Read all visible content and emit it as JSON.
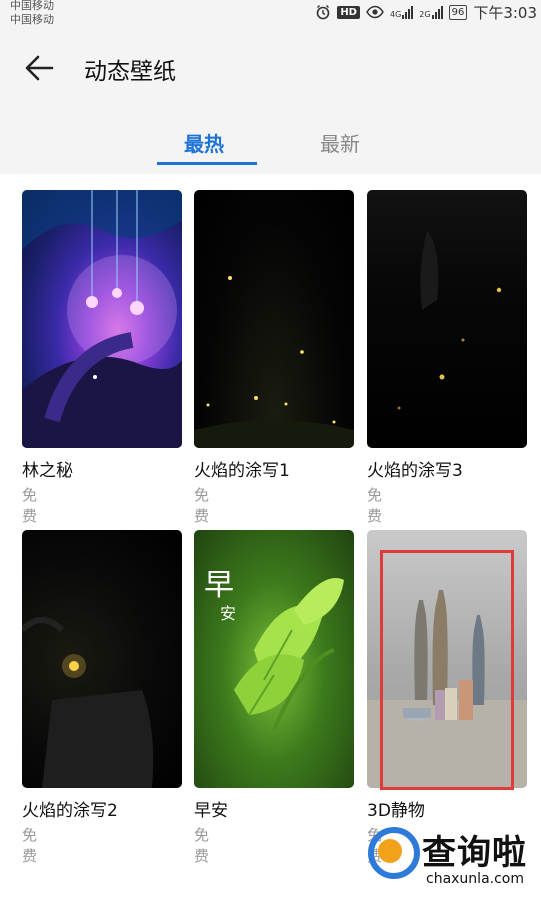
{
  "status_bar": {
    "carrier_1": "中国移动",
    "carrier_2": "中国移动",
    "hd_label": "HD",
    "signal_1_label": "4G",
    "signal_2_label": "2G",
    "battery": "96",
    "time": "下午3:03",
    "icons": [
      "alarm-icon",
      "hd-icon",
      "eye-icon",
      "signal-icon",
      "signal-icon",
      "battery-icon"
    ]
  },
  "header": {
    "title": "动态壁纸",
    "back_icon": "back-arrow-icon"
  },
  "tabs": [
    {
      "label": "最热",
      "active": true
    },
    {
      "label": "最新",
      "active": false
    }
  ],
  "wallpapers": [
    {
      "name": "林之秘",
      "price": "免费"
    },
    {
      "name": "火焰的涂写1",
      "price": "免费"
    },
    {
      "name": "火焰的涂写3",
      "price": "免费"
    },
    {
      "name": "火焰的涂写2",
      "price": "免费"
    },
    {
      "name": "早安",
      "price": "免费",
      "overlay_char_1": "早",
      "overlay_char_2": "安"
    },
    {
      "name": "3D静物",
      "price": "免费"
    }
  ],
  "watermark": {
    "title": "查询啦",
    "url": "chaxunla.com"
  },
  "colors": {
    "accent": "#1e74d6",
    "highlight_box": "#e03b3b"
  }
}
